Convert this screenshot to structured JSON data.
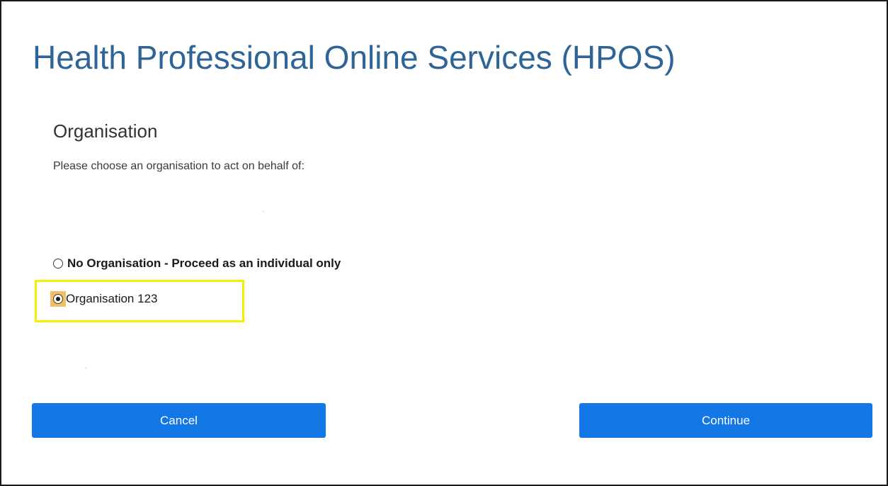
{
  "header": {
    "title": "Health Professional Online Services (HPOS)"
  },
  "section": {
    "title": "Organisation",
    "instructions": "Please choose an organisation to act on behalf of:"
  },
  "organisation_options": [
    {
      "label": "No Organisation - Proceed as an individual only",
      "selected": false
    },
    {
      "label": "Organisation 123",
      "selected": true
    }
  ],
  "actions": {
    "cancel_label": "Cancel",
    "continue_label": "Continue"
  },
  "colors": {
    "title": "#2f6496",
    "button": "#1377e6",
    "highlight": "#f4ef00",
    "focus": "#f2c064"
  }
}
